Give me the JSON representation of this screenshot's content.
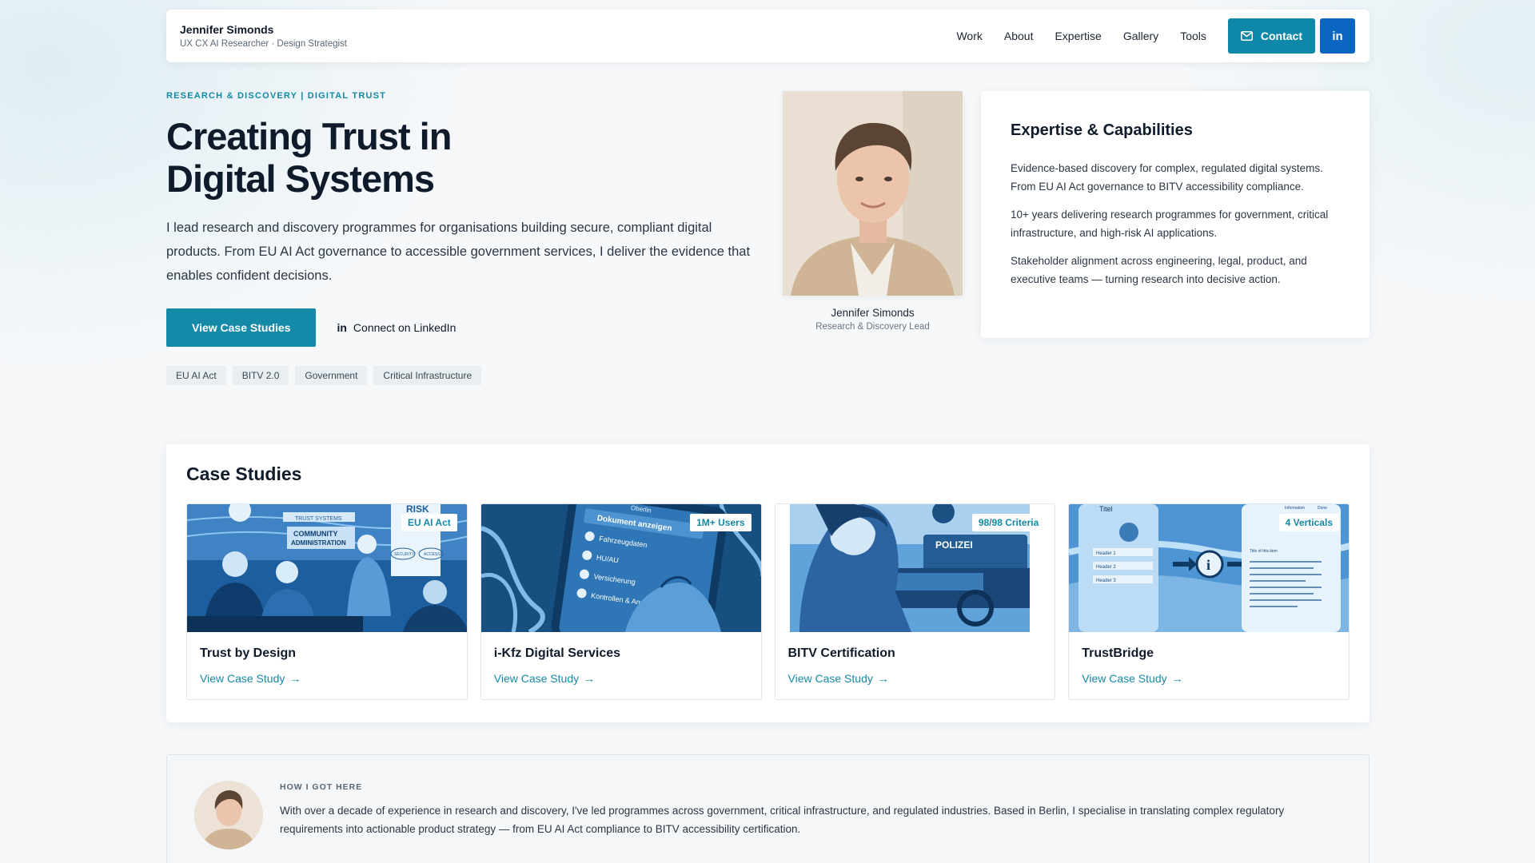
{
  "header": {
    "name": "Jennifer Simonds",
    "subtitle": "UX CX AI Researcher · Design Strategist",
    "nav": [
      "Work",
      "About",
      "Expertise",
      "Gallery",
      "Tools"
    ],
    "contact_label": "Contact"
  },
  "hero": {
    "eyebrow": "RESEARCH & DISCOVERY | DIGITAL TRUST",
    "title_line1": "Creating Trust in",
    "title_line2": "Digital Systems",
    "body": "I lead research and discovery programmes for organisations building secure, compliant digital products. From EU AI Act governance to accessible government services, I deliver the evidence that enables confident decisions.",
    "primary_cta": "View Case Studies",
    "secondary_cta": "Connect on LinkedIn",
    "tags": [
      "EU AI Act",
      "BITV 2.0",
      "Government",
      "Critical Infrastructure"
    ]
  },
  "portrait": {
    "name": "Jennifer Simonds",
    "role": "Research & Discovery Lead"
  },
  "expertise": {
    "title": "Expertise & Capabilities",
    "paragraphs": [
      "Evidence-based discovery for complex, regulated digital systems. From EU AI Act governance to BITV accessibility compliance.",
      "10+ years delivering research programmes for government, critical infrastructure, and high-risk AI applications.",
      "Stakeholder alignment across engineering, legal, product, and executive teams — turning research into decisive action."
    ]
  },
  "cases": {
    "title": "Case Studies",
    "items": [
      {
        "title": "Trust by Design",
        "badge": "EU AI Act",
        "link": "View Case Study"
      },
      {
        "title": "i-Kfz Digital Services",
        "badge": "1M+ Users",
        "link": "View Case Study"
      },
      {
        "title": "BITV Certification",
        "badge": "98/98 Criteria",
        "link": "View Case Study"
      },
      {
        "title": "TrustBridge",
        "badge": "4 Verticals",
        "link": "View Case Study"
      }
    ],
    "image_texts": {
      "c1": [
        "TRUST SYSTEMS",
        "COMMUNITY",
        "ADMINISTRATION",
        "RISK",
        "SECURITY",
        "ACCESS"
      ],
      "c2": [
        "Oberlin",
        "Dokument anzeigen",
        "Fahrzeugdaten",
        "HU/AU",
        "Versicherung",
        "Kontrollen & Anpassun"
      ],
      "c3": [
        "POLIZEI"
      ],
      "c4": [
        "Titel",
        "Header 1",
        "Header 2",
        "Header 3",
        "Information",
        "Done",
        "Title of this item"
      ]
    }
  },
  "about": {
    "label": "HOW I GOT HERE",
    "body": "With over a decade of experience in research and discovery, I've led programmes across government, critical infrastructure, and regulated industries. Based in Berlin, I specialise in translating complex regulatory requirements into actionable product strategy — from EU AI Act compliance to BITV accessibility certification."
  },
  "colors": {
    "accent": "#1589a8",
    "linkedin": "#0a66c2",
    "text": "#0f1b2a"
  }
}
